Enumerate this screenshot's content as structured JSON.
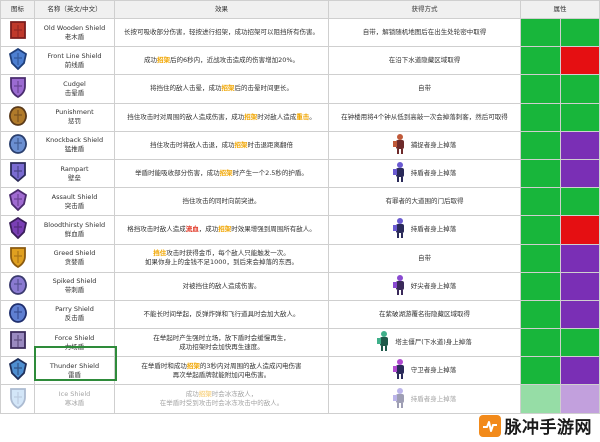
{
  "headers": {
    "icon": "图标",
    "name": "名称（英文/中文）",
    "effect": "效果",
    "acquire": "获得方式",
    "attribute": "属性"
  },
  "colors": {
    "green": "#18b63b",
    "red": "#e50f12",
    "purple": "#7a2fb5",
    "highlight_orange": "#f0a500",
    "highlight_red": "#e0301e"
  },
  "rows": [
    {
      "icon": "old-wooden-shield-icon",
      "name_en": "Old Wooden Shield",
      "name_cn": "老木盾",
      "effect": [
        {
          "t": "长按可吸收部分伤害，轻按进行招架，成功招架可以阻挡所有伤害。"
        }
      ],
      "acquire": "自带，解锁随机地图后在出生处轮密中取得",
      "drop_icon": "",
      "attr": [
        "green",
        "green"
      ]
    },
    {
      "icon": "front-line-shield-icon",
      "name_en": "Front Line Shield",
      "name_cn": "前线盾",
      "effect": [
        {
          "t": "成功"
        },
        {
          "t": "招架",
          "c": "orange"
        },
        {
          "t": "后的6秒内，近战攻击造成的伤害增加20%。"
        }
      ],
      "acquire": "在沿下水道隐藏区域取得",
      "drop_icon": "",
      "attr": [
        "green",
        "red"
      ]
    },
    {
      "icon": "cudgel-icon",
      "name_en": "Cudgel",
      "name_cn": "击晕盾",
      "effect": [
        {
          "t": "将挡住的敌人击晕，成功"
        },
        {
          "t": "招架",
          "c": "orange"
        },
        {
          "t": "后的击晕时间更长。"
        }
      ],
      "acquire": "自带",
      "drop_icon": "",
      "attr": [
        "green",
        "green"
      ]
    },
    {
      "icon": "punishment-icon",
      "name_en": "Punishment",
      "name_cn": "惩罚",
      "effect": [
        {
          "t": "挡住攻击时对周围的敌人造成伤害，成功"
        },
        {
          "t": "招架",
          "c": "orange"
        },
        {
          "t": "时对敌人造成"
        },
        {
          "t": "重击",
          "c": "orange"
        },
        {
          "t": "。"
        }
      ],
      "acquire": "在钟楼用将4个钟从低到高敲一次会掉落刺客，然后可取得",
      "drop_icon": "",
      "attr": [
        "green",
        "green"
      ]
    },
    {
      "icon": "knockback-shield-icon",
      "name_en": "Knockback Shield",
      "name_cn": "猛推盾",
      "effect": [
        {
          "t": "挡住攻击时将敌人击退，成功"
        },
        {
          "t": "招架",
          "c": "orange"
        },
        {
          "t": "时击退距离翻倍"
        }
      ],
      "acquire": "捕捉者身上掉落",
      "drop_icon": "knight-enemy",
      "attr": [
        "green",
        "purple"
      ]
    },
    {
      "icon": "rampart-icon",
      "name_en": "Rampart",
      "name_cn": "壁垒",
      "effect": [
        {
          "t": "举盾时能吸收部分伤害，成功"
        },
        {
          "t": "招架",
          "c": "orange"
        },
        {
          "t": "时产生一个2.5秒的护盾。"
        }
      ],
      "acquire": "持盾者身上掉落",
      "drop_icon": "shieldbearer-enemy",
      "attr": [
        "green",
        "purple"
      ]
    },
    {
      "icon": "assault-shield-icon",
      "name_en": "Assault Shield",
      "name_cn": "突击盾",
      "effect": [
        {
          "t": "挡住攻击的同时向前突进。"
        }
      ],
      "acquire": "有罪者的大道围的门后取得",
      "drop_icon": "",
      "attr": [
        "green",
        "green"
      ]
    },
    {
      "icon": "bloodthirsty-shield-icon",
      "name_en": "Bloodthirsty Shield",
      "name_cn": "鲜血盾",
      "effect": [
        {
          "t": "格挡攻击时敌人造成"
        },
        {
          "t": "流血",
          "c": "red"
        },
        {
          "t": "，成功"
        },
        {
          "t": "招架",
          "c": "orange"
        },
        {
          "t": "时效果增强到周围所有敌人。"
        }
      ],
      "acquire": "持盾者身上掉落",
      "drop_icon": "shieldbearer-enemy",
      "attr": [
        "green",
        "red"
      ]
    },
    {
      "icon": "greed-shield-icon",
      "name_en": "Greed Shield",
      "name_cn": "贪婪盾",
      "effect": [
        {
          "t": "挡住",
          "c": "orange"
        },
        {
          "t": "攻击时获得金币，每个敌人只能触发一次。"
        },
        {
          "t": "如果你身上的金钱不足1000，到后来会掉落的东西。",
          "br": true
        }
      ],
      "acquire": "自带",
      "drop_icon": "",
      "attr": [
        "green",
        "purple"
      ]
    },
    {
      "icon": "spiked-shield-icon",
      "name_en": "Spiked Shield",
      "name_cn": "带刺盾",
      "effect": [
        {
          "t": "对被挡住的敌人造成伤害。"
        }
      ],
      "acquire": "好尖者身上掉落",
      "drop_icon": "spiked-enemy",
      "attr": [
        "green",
        "purple"
      ]
    },
    {
      "icon": "parry-shield-icon",
      "name_en": "Parry Shield",
      "name_cn": "反击盾",
      "effect": [
        {
          "t": "不能长时间举起，反弹炸弹和飞行道具时会加大敌人。"
        }
      ],
      "acquire": "在紫破湖游覆名街隐藏区域取得",
      "drop_icon": "",
      "attr": [
        "green",
        "purple"
      ]
    },
    {
      "icon": "force-shield-icon",
      "name_en": "Force Shield",
      "name_cn": "力场盾",
      "effect": [
        {
          "t": "在举起时产生强时立场，放下盾时会缓慢再生，"
        },
        {
          "t": "成功招架时会加快再生速度。",
          "br": true
        }
      ],
      "acquire": "塔主僵尸(下水道)身上掉落",
      "drop_icon": "zombie-enemy",
      "attr": [
        "green",
        "green"
      ]
    },
    {
      "icon": "thunder-shield-icon",
      "name_en": "Thunder Shield",
      "name_cn": "雷盾",
      "effect": [
        {
          "t": "在举盾时和成功"
        },
        {
          "t": "招架",
          "c": "orange"
        },
        {
          "t": "的3秒内对周围的敌人造成闪电伤害"
        },
        {
          "t": "再次举起盾牌就能附加闪电伤害。",
          "br": true
        }
      ],
      "acquire": "守卫者身上掉落",
      "drop_icon": "guard-enemy",
      "attr": [
        "green",
        "purple"
      ]
    },
    {
      "icon": "ice-shield-icon",
      "name_en": "Ice Shield",
      "name_cn": "寒冰盾",
      "effect": [
        {
          "t": "成功"
        },
        {
          "t": "招架",
          "c": "orange"
        },
        {
          "t": "时会冰冻敌人，"
        },
        {
          "t": "在举盾时受到攻击时会冰冻攻击中的敌人。",
          "br": true
        }
      ],
      "acquire": "持盾者身上掉落",
      "drop_icon": "shieldbearer-enemy",
      "attr": [
        "green",
        "purple"
      ],
      "faded": true
    }
  ],
  "watermark": {
    "text": "脉冲手游网",
    "badge_icon": "pulse-icon"
  }
}
